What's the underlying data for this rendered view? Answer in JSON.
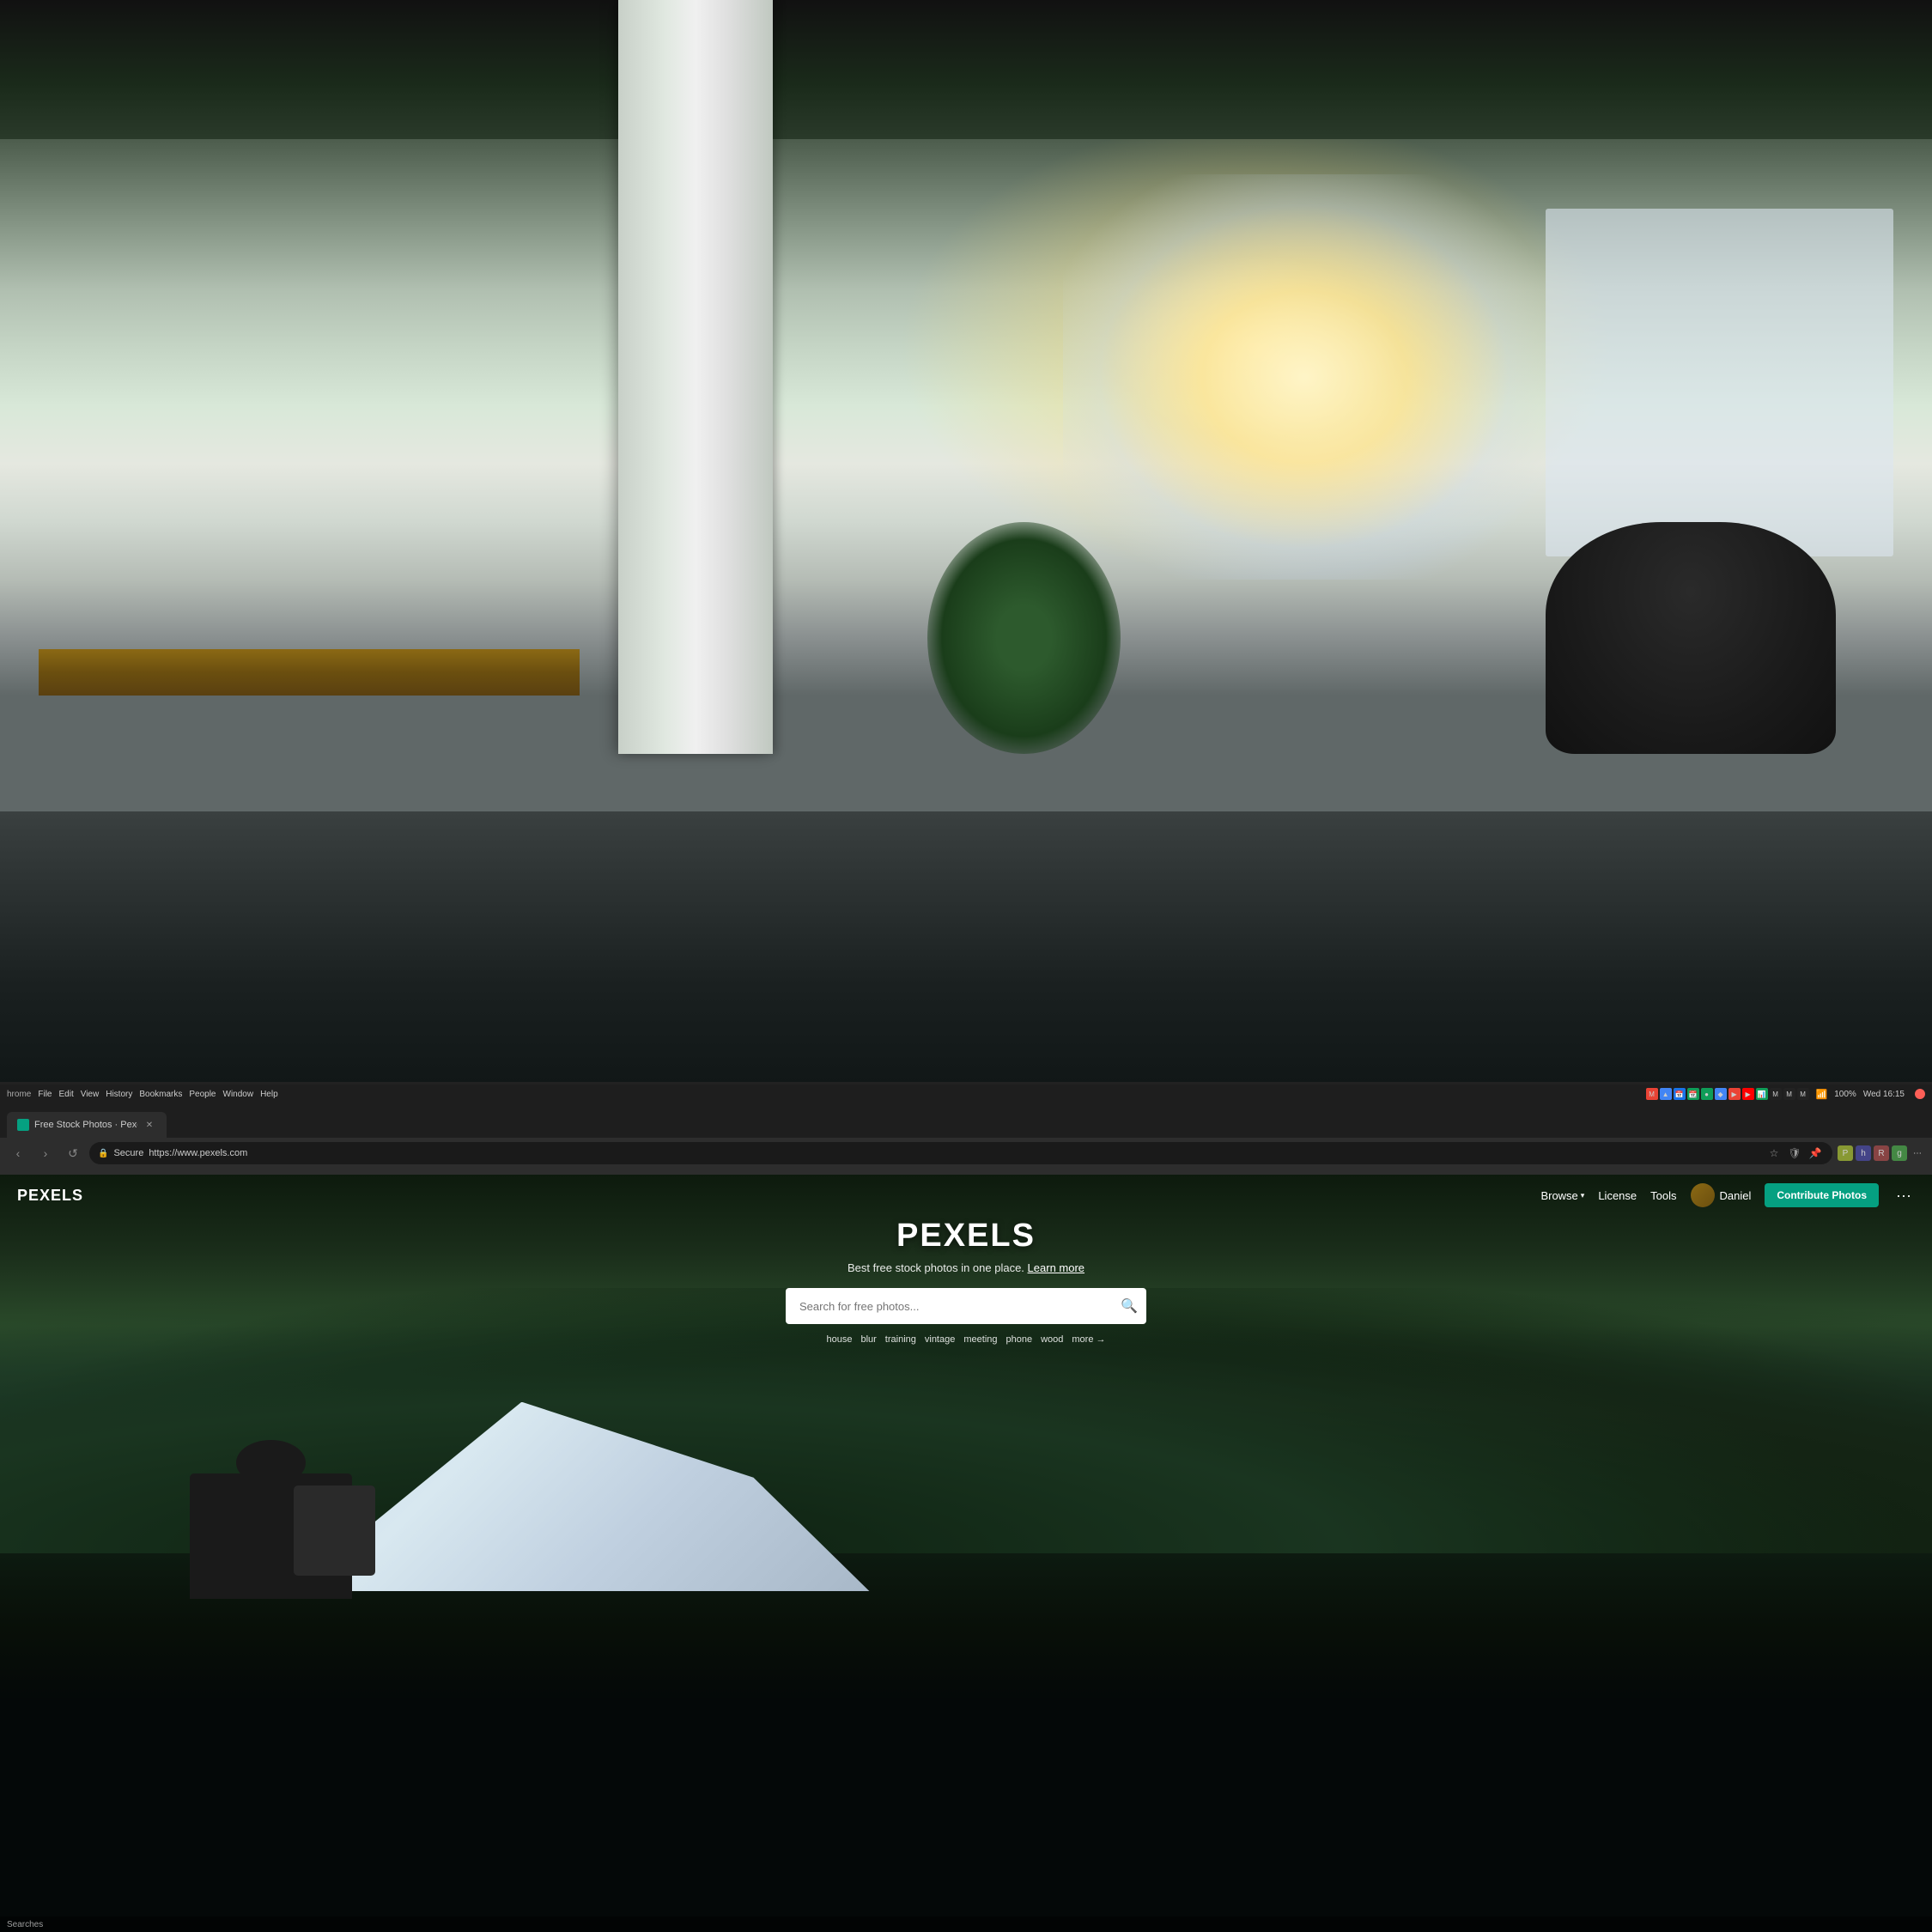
{
  "photo": {
    "alt": "Office interior background photo",
    "description": "Blurred office space with plants, windows, desk and chair"
  },
  "system_bar": {
    "time": "Wed 16:15",
    "battery": "100%",
    "battery_icon": "🔋"
  },
  "browser": {
    "tab": {
      "title": "Free Stock Photos · Pexels",
      "favicon_color": "#05a081"
    },
    "nav": {
      "back_label": "‹",
      "forward_label": "›",
      "reload_label": "↺"
    },
    "address": {
      "protocol": "Secure",
      "url": "https://www.pexels.com",
      "secure_icon": "🔒"
    }
  },
  "pexels": {
    "logo": "PEXELS",
    "nav": {
      "browse_label": "Browse",
      "browse_dropdown": true,
      "license_label": "License",
      "tools_label": "Tools",
      "user_name": "Daniel",
      "contribute_label": "Contribute Photos",
      "more_label": "···"
    },
    "hero": {
      "title": "PEXELS",
      "subtitle": "Best free stock photos in one place.",
      "learn_more_label": "Learn more"
    },
    "search": {
      "placeholder": "Search for free photos...",
      "button_icon": "🔍"
    },
    "keywords": [
      "house",
      "blur",
      "training",
      "vintage",
      "meeting",
      "phone",
      "wood"
    ],
    "more_label": "more →"
  },
  "status_bar": {
    "text": "Searches"
  }
}
